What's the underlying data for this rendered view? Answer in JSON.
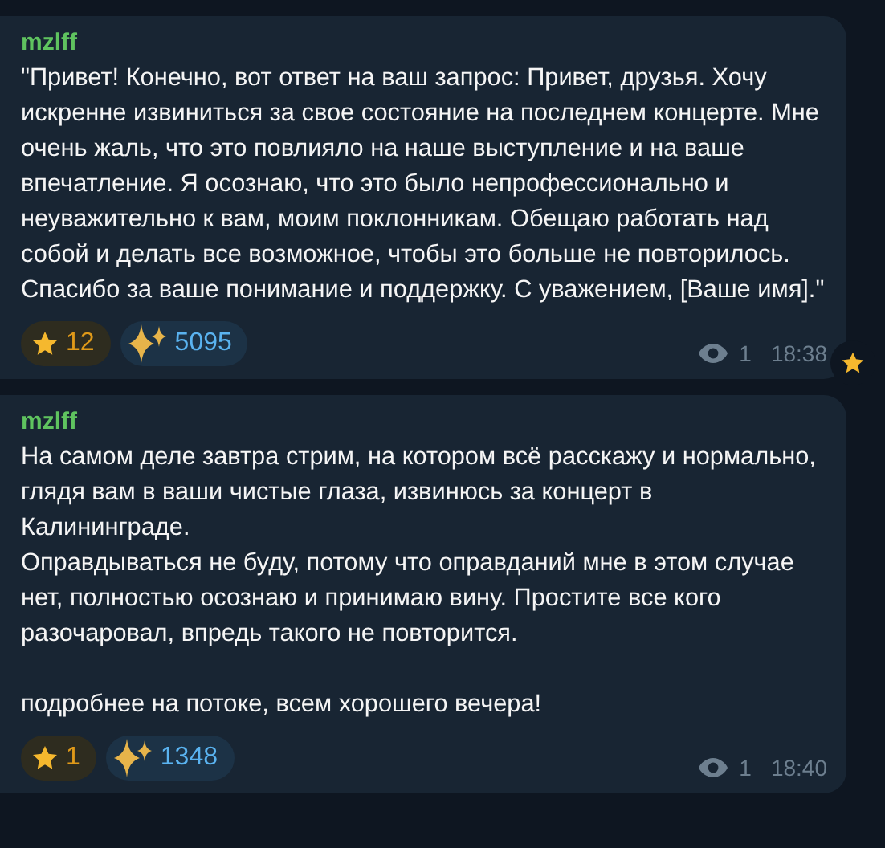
{
  "messages": [
    {
      "author": "mzlff",
      "paragraphs": [
        "\"Привет! Конечно, вот ответ на ваш запрос: Привет, друзья. Хочу искренне извиниться за свое состояние на последнем концерте. Мне очень жаль, что это повлияло на наше выступление и на ваше впечатление. Я осознаю, что это было непрофессионально и неуважительно к вам, моим поклонникам. Обещаю работать над собой и делать все возможное, чтобы это больше не повторилось. Спасибо за ваше понимание и поддержку. С уважением, [Ваше имя].\""
      ],
      "reactions": [
        {
          "kind": "star",
          "count": "12"
        },
        {
          "kind": "sparkle",
          "count": "5095"
        }
      ],
      "views": "1",
      "time": "18:38",
      "starred": true
    },
    {
      "author": "mzlff",
      "paragraphs": [
        "На самом деле завтра стрим, на котором всё расскажу и нормально, глядя вам в ваши чистые глаза, извинюсь за концерт в Калининграде.",
        "Оправдываться не буду, потому что оправданий мне в этом случае нет, полностью осознаю и принимаю вину. Простите все кого разочаровал, впредь такого не повторится.",
        "подробнее на потоке, всем хорошего вечера!"
      ],
      "reactions": [
        {
          "kind": "star",
          "count": "1"
        },
        {
          "kind": "sparkle",
          "count": "1348"
        }
      ],
      "views": "1",
      "time": "18:40",
      "starred": false
    }
  ]
}
